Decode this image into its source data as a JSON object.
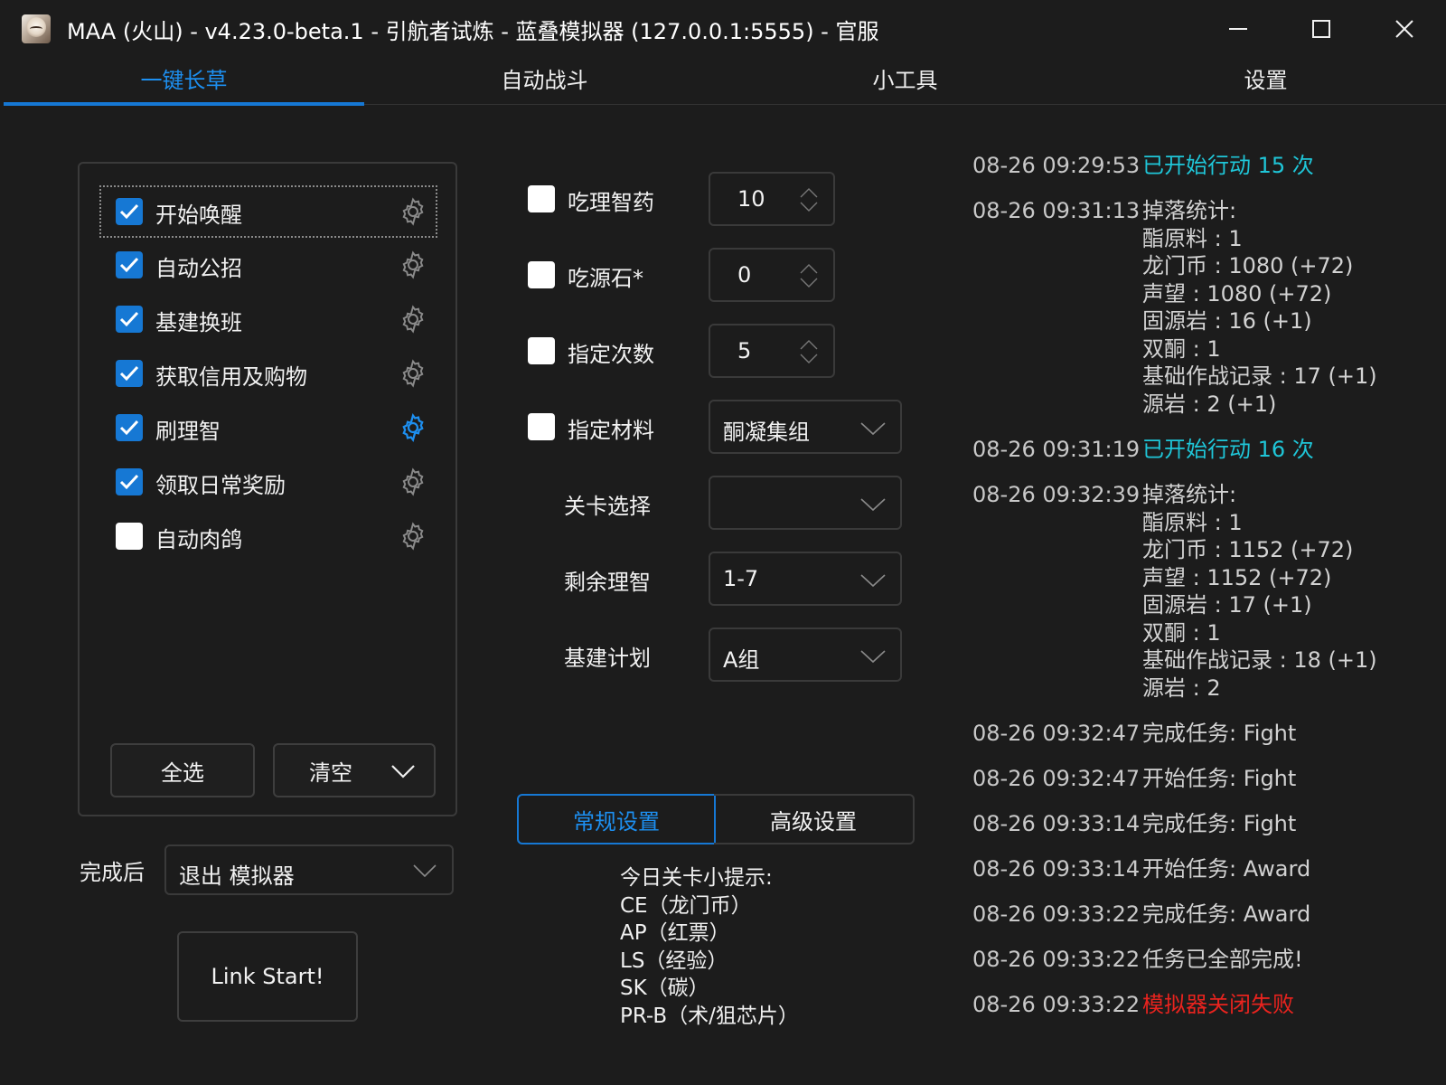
{
  "window": {
    "title": "MAA (火山) - v4.23.0-beta.1 - 引航者试炼 - 蓝叠模拟器 (127.0.0.1:5555) - 官服",
    "icon": "maa-app-icon"
  },
  "tabs": [
    {
      "label": "一键长草",
      "active": true
    },
    {
      "label": "自动战斗",
      "active": false
    },
    {
      "label": "小工具",
      "active": false
    },
    {
      "label": "设置",
      "active": false
    }
  ],
  "tasks": [
    {
      "label": "开始唤醒",
      "checked": true
    },
    {
      "label": "自动公招",
      "checked": true
    },
    {
      "label": "基建换班",
      "checked": true
    },
    {
      "label": "获取信用及购物",
      "checked": true
    },
    {
      "label": "刷理智",
      "checked": true
    },
    {
      "label": "领取日常奖励",
      "checked": true
    },
    {
      "label": "自动肉鸽",
      "checked": false
    }
  ],
  "task_buttons": {
    "select_all": "全选",
    "clear": "清空"
  },
  "after": {
    "label": "完成后",
    "value": "退出 模拟器"
  },
  "start_button": "Link Start!",
  "fight": {
    "medicine": {
      "label": "吃理智药",
      "value": "10"
    },
    "stone": {
      "label": "吃源石*",
      "value": "0"
    },
    "times": {
      "label": "指定次数",
      "value": "5"
    },
    "material": {
      "label": "指定材料",
      "value": "酮凝集组"
    },
    "stage": {
      "label": "关卡选择",
      "value": ""
    },
    "remaining": {
      "label": "剩余理智",
      "value": "1-7"
    },
    "infrast": {
      "label": "基建计划",
      "value": "A组"
    }
  },
  "settings_tabs": {
    "general": "常规设置",
    "advanced": "高级设置"
  },
  "tips": {
    "title": "今日关卡小提示:",
    "lines": [
      "CE（龙门币）",
      "AP（红票）",
      "LS（经验）",
      "SK（碳）",
      "PR-B（术/狙芯片）"
    ]
  },
  "colors": {
    "accent": "#1678d4",
    "log_info": "#1fc6d8",
    "log_error": "#e8231e",
    "background": "#1c1c1c"
  },
  "log": [
    {
      "time": "08-26  09:29:53",
      "lines": [
        "已开始行动 15 次"
      ],
      "color": "cyan"
    },
    {
      "time": "08-26  09:31:13",
      "lines": [
        "掉落统计:",
        "酯原料 : 1",
        "龙门币 : 1080 (+72)",
        "声望 : 1080 (+72)",
        "固源岩 : 16 (+1)",
        "双酮 : 1",
        "基础作战记录 : 17 (+1)",
        "源岩 : 2 (+1)"
      ],
      "color": "normal"
    },
    {
      "time": "08-26  09:31:19",
      "lines": [
        "已开始行动 16 次"
      ],
      "color": "cyan"
    },
    {
      "time": "08-26  09:32:39",
      "lines": [
        "掉落统计:",
        "酯原料 : 1",
        "龙门币 : 1152 (+72)",
        "声望 : 1152 (+72)",
        "固源岩 : 17 (+1)",
        "双酮 : 1",
        "基础作战记录 : 18 (+1)",
        "源岩 : 2"
      ],
      "color": "normal"
    },
    {
      "time": "08-26  09:32:47",
      "lines": [
        "完成任务: Fight"
      ],
      "color": "normal"
    },
    {
      "time": "08-26  09:32:47",
      "lines": [
        "开始任务: Fight"
      ],
      "color": "normal"
    },
    {
      "time": "08-26  09:33:14",
      "lines": [
        "完成任务: Fight"
      ],
      "color": "normal"
    },
    {
      "time": "08-26  09:33:14",
      "lines": [
        "开始任务: Award"
      ],
      "color": "normal"
    },
    {
      "time": "08-26  09:33:22",
      "lines": [
        "完成任务: Award"
      ],
      "color": "normal"
    },
    {
      "time": "08-26  09:33:22",
      "lines": [
        "任务已全部完成!"
      ],
      "color": "normal"
    },
    {
      "time": "08-26  09:33:22",
      "lines": [
        "模拟器关闭失败"
      ],
      "color": "red"
    }
  ]
}
